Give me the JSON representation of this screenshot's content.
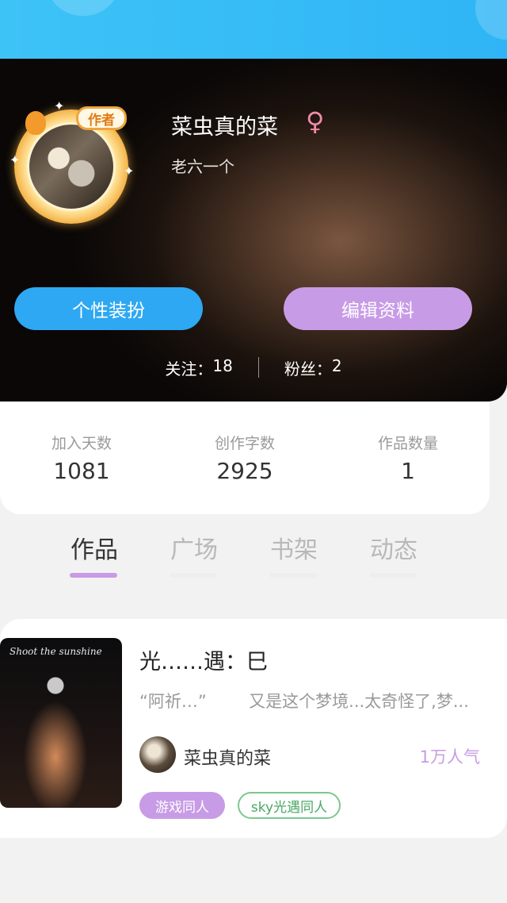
{
  "profile": {
    "name": "菜虫真的菜",
    "gender_symbol": "♀",
    "bio": "老六一个",
    "badge": "作者"
  },
  "actions": {
    "dress_up": "个性装扮",
    "edit_profile": "编辑资料"
  },
  "follow": {
    "following_label": "关注：",
    "following_count": "18",
    "fans_label": "粉丝：",
    "fans_count": "2"
  },
  "stats": [
    {
      "label": "加入天数",
      "value": "1081"
    },
    {
      "label": "创作字数",
      "value": "2925"
    },
    {
      "label": "作品数量",
      "value": "1"
    }
  ],
  "tabs": [
    {
      "label": "作品",
      "active": true
    },
    {
      "label": "广场",
      "active": false
    },
    {
      "label": "书架",
      "active": false
    },
    {
      "label": "动态",
      "active": false
    }
  ],
  "works": [
    {
      "cover_text": "Shoot the sunshine",
      "title": "光……遇：巳",
      "excerpt": "“阿祈…”        又是这个梦境...太奇怪了,梦...",
      "author": "菜虫真的菜",
      "popularity": "1万人气",
      "tags": [
        "游戏同人",
        "sky光遇同人"
      ]
    }
  ],
  "colors": {
    "top_bar": "#2fb5f5",
    "primary_blue": "#2ea8f2",
    "accent_purple": "#c79be6",
    "tag_green": "#4aa862",
    "gender_pink": "#f28aa8"
  }
}
